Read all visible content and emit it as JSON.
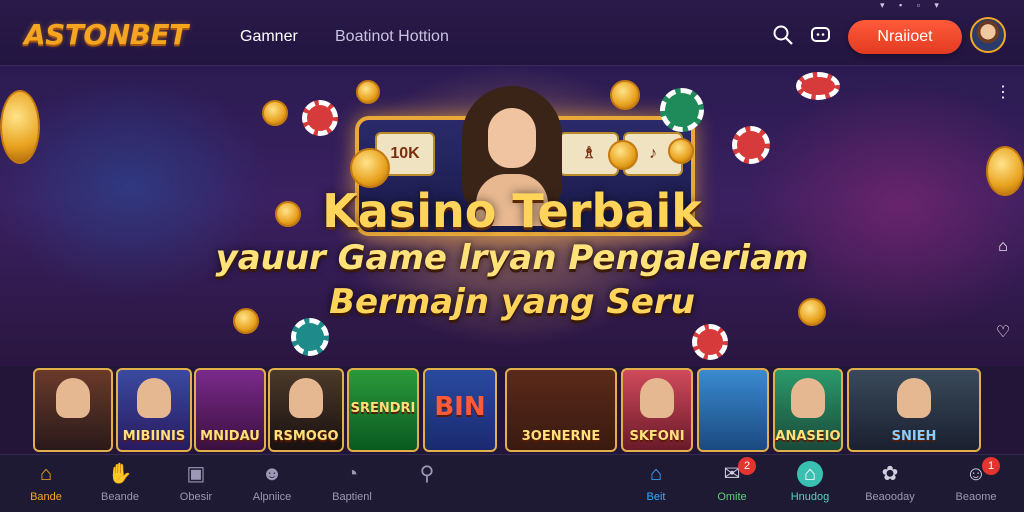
{
  "header": {
    "logo": "ASTONBET",
    "nav": [
      "Gamner",
      "Boatinot Hottion"
    ],
    "login_label": "Nraiioet",
    "icons": [
      "search-icon",
      "chat-icon",
      "avatar"
    ]
  },
  "hero": {
    "title": "Kasino Terbaik",
    "subtitle_line1": "yauur Game lryan Pengaleriam",
    "subtitle_line2": "Bermajn yang Seru",
    "reel_labels": [
      "10K",
      "♗",
      "♪"
    ]
  },
  "games": [
    {
      "caption": ""
    },
    {
      "caption": "MIBIINIS"
    },
    {
      "caption": "MNIDAU"
    },
    {
      "caption": "RSMOGO"
    },
    {
      "caption": "SRENDRI"
    },
    {
      "caption": "BIN"
    },
    {
      "caption": "3OENERNE"
    },
    {
      "caption": "SKFONI"
    },
    {
      "caption": ""
    },
    {
      "caption": "ANASEIO"
    },
    {
      "caption": "SNIEH"
    }
  ],
  "bottom_nav": [
    {
      "label": "Bande",
      "icon": "home-icon"
    },
    {
      "label": "Beande",
      "icon": "hand-icon"
    },
    {
      "label": "Obesir",
      "icon": "slot-icon"
    },
    {
      "label": "Alpniice",
      "icon": "chat-bubble-icon"
    },
    {
      "label": "Baptienl",
      "icon": "gift-icon"
    },
    {
      "label": "",
      "icon": "search-icon"
    },
    {
      "label": "Beit",
      "icon": "house-icon"
    },
    {
      "label": "Omite",
      "icon": "chat-icon",
      "badge": "2"
    },
    {
      "label": "Hnudog",
      "icon": "home-circle-icon"
    },
    {
      "label": "Beaooday",
      "icon": "friends-icon"
    },
    {
      "label": "Beaome",
      "icon": "profile-icon",
      "badge": "1"
    }
  ],
  "colors": {
    "accent": "#f4a623",
    "login": "#e8402a",
    "active_blue": "#3aa9ff"
  }
}
